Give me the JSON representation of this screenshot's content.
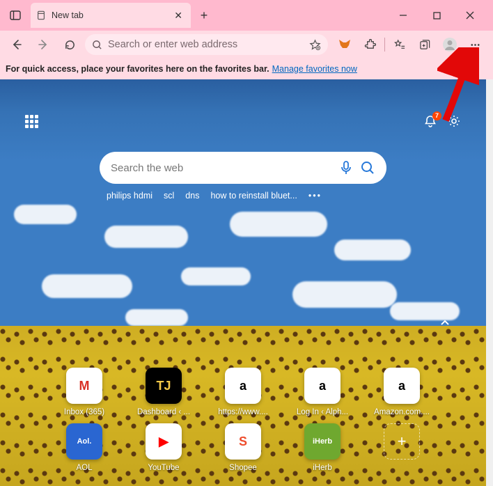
{
  "window": {
    "tab_title": "New tab"
  },
  "address_bar": {
    "placeholder": "Search or enter web address"
  },
  "favorites_hint": {
    "text": "For quick access, place your favorites here on the favorites bar.",
    "link": "Manage favorites now"
  },
  "ntp": {
    "notification_count": "7",
    "search_placeholder": "Search the web",
    "suggestions": [
      "philips hdmi",
      "scl",
      "dns",
      "how to reinstall bluet..."
    ],
    "quicklinks_row1": [
      {
        "label": "Inbox (365)",
        "tile_text": "M",
        "bg": "#ffffff",
        "fg": "#d93025"
      },
      {
        "label": "Dashboard ‹ ...",
        "tile_text": "TJ",
        "bg": "#000000",
        "fg": "#f7c948"
      },
      {
        "label": "https://www....",
        "tile_text": "a",
        "bg": "#ffffff",
        "fg": "#000000"
      },
      {
        "label": "Log In ‹ Alph...",
        "tile_text": "a",
        "bg": "#ffffff",
        "fg": "#000000"
      },
      {
        "label": "Amazon.com....",
        "tile_text": "a",
        "bg": "#ffffff",
        "fg": "#000000"
      }
    ],
    "quicklinks_row2": [
      {
        "label": "AOL",
        "tile_text": "Aol.",
        "bg": "#2a66d1",
        "fg": "#ffffff"
      },
      {
        "label": "YouTube",
        "tile_text": "▶",
        "bg": "#ffffff",
        "fg": "#ff0000"
      },
      {
        "label": "Shopee",
        "tile_text": "S",
        "bg": "#ffffff",
        "fg": "#ee4d2d"
      },
      {
        "label": "iHerb",
        "tile_text": "iHerb",
        "bg": "#6fa82f",
        "fg": "#ffffff"
      }
    ]
  }
}
